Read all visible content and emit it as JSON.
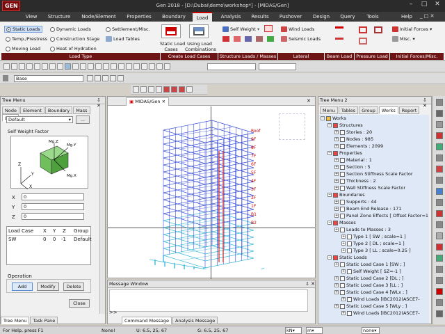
{
  "titlebar": {
    "text": "Gen 2018 - [D:\\Dubai\\demo\\workshop*] - [MIDAS/Gen]",
    "logo": "GEN"
  },
  "menu": {
    "tabs": [
      "View",
      "Structure",
      "Node/Element",
      "Properties",
      "Boundary",
      "Load",
      "Analysis",
      "Results",
      "Pushover",
      "Design",
      "Query",
      "Tools"
    ],
    "active": "Load",
    "help": "Help"
  },
  "ribbon": {
    "load_type_items": [
      "Static Loads",
      "Dynamic Loads",
      "Settlement/Misc.",
      "Temp./Prestress",
      "Construction Stage",
      "Heat of Hydration",
      "Moving Load"
    ],
    "load_type_sub": "Load Tables",
    "groups": [
      "Load Type",
      "Create Load Cases",
      "Structure Loads / Masses",
      "Lateral",
      "Beam Load",
      "Pressure Load",
      "Initial Forces/Misc."
    ],
    "static_load_cases": "Static Load\nCases",
    "static_load_cases_lines": [
      "Static Load",
      "Cases"
    ],
    "using_load_combinations_lines": [
      "Using Load",
      "Combinations"
    ],
    "self_weight": "Self Weight",
    "nodal_body_force": "",
    "wind_loads": "Wind Loads",
    "seismic_loads": "Seismic Loads",
    "initial_forces": "Initial Forces",
    "misc": "Misc."
  },
  "toolbar": {
    "base_field": "Base"
  },
  "tree_menu": {
    "title": "Tree Menu",
    "tabs": [
      "Node",
      "Element",
      "Boundary",
      "Mass",
      "Load"
    ],
    "active_tab": "Load",
    "default_select": "Default",
    "self_weight_factor": "Self Weight Factor",
    "axis_labels": [
      "Mg.Z",
      "Mg.Y",
      "Mg.X",
      "Z",
      "Y",
      "X"
    ],
    "x_label": "X",
    "x_value": "0",
    "y_label": "Y",
    "y_value": "0",
    "z_label": "Z",
    "z_value": "0",
    "table_headers": [
      "Load Case",
      "X",
      "Y",
      "Z",
      "Group"
    ],
    "table_row": [
      "SW",
      "0",
      "0",
      "-1",
      "Default"
    ],
    "operation": "Operation",
    "add": "Add",
    "modify": "Modify",
    "delete": "Delete",
    "close": "Close",
    "bottom_tabs": [
      "Tree Menu",
      "Task Pane"
    ]
  },
  "model_view": {
    "tab": "MIDAS/Gen",
    "story_labels": [
      "Roof",
      "9F",
      "8F",
      "7F",
      "6F",
      "5F",
      "4F",
      "3F",
      "2F",
      "1F",
      "B1",
      "B2"
    ]
  },
  "message_window": {
    "title": "Message Window",
    "prompt": ">>",
    "tabs": [
      "Command Message",
      "Analysis Message"
    ]
  },
  "tree_menu2": {
    "title": "Tree Menu 2",
    "tabs": [
      "Menu",
      "Tables",
      "Group",
      "Works",
      "Report"
    ],
    "active_tab": "Works",
    "items": [
      {
        "level": 0,
        "text": "Works"
      },
      {
        "level": 1,
        "text": "Structures"
      },
      {
        "level": 2,
        "text": "Stories : 20"
      },
      {
        "level": 2,
        "text": "Nodes : 985"
      },
      {
        "level": 2,
        "text": "Elements : 2099"
      },
      {
        "level": 1,
        "text": "Properties"
      },
      {
        "level": 2,
        "text": "Material : 1"
      },
      {
        "level": 2,
        "text": "Section : 5"
      },
      {
        "level": 2,
        "text": "Section Stiffness Scale Factor"
      },
      {
        "level": 2,
        "text": "Thickness : 2"
      },
      {
        "level": 2,
        "text": "Wall Stiffness Scale Factor"
      },
      {
        "level": 1,
        "text": "Boundaries"
      },
      {
        "level": 2,
        "text": "Supports : 44"
      },
      {
        "level": 2,
        "text": "Beam End Release : 171"
      },
      {
        "level": 2,
        "text": "Panel Zone Effects [ Offset Factor=1 ;"
      },
      {
        "level": 1,
        "text": "Masses"
      },
      {
        "level": 2,
        "text": "Loads to Masses : 3"
      },
      {
        "level": 3,
        "text": "Type 1 [ SW ; scale=1 ]"
      },
      {
        "level": 3,
        "text": "Type 2 [ DL ; scale=1 ]"
      },
      {
        "level": 3,
        "text": "Type 3 [ LL ; scale=0.25 ]"
      },
      {
        "level": 1,
        "text": "Static Loads"
      },
      {
        "level": 2,
        "text": "Static Load Case 1 [SW ; ]"
      },
      {
        "level": 3,
        "text": "Self Weight [ SZ=-1 ]"
      },
      {
        "level": 2,
        "text": "Static Load Case 2 [DL ; ]"
      },
      {
        "level": 2,
        "text": "Static Load Case 3 [LL ; ]"
      },
      {
        "level": 2,
        "text": "Static Load Case 4 [WLx ; ]"
      },
      {
        "level": 3,
        "text": "Wind Loads [IBC2012(ASCE7-"
      },
      {
        "level": 2,
        "text": "Static Load Case 5 [WLy ; ]"
      },
      {
        "level": 3,
        "text": "Wind Loads [IBC2012(ASCE7-"
      }
    ]
  },
  "status": {
    "help": "For Help, press F1",
    "sel": "None!",
    "u": "U: 6.5, 25, 67",
    "g": "G: 6.5, 25, 67",
    "unit_force": "kN",
    "unit_len": "m",
    "none": "none"
  },
  "colors": {
    "accent": "#c00000",
    "group_bar": "#6d1414",
    "tree_bg": "#dfe8f6",
    "frame_blue": "#3a4fd8",
    "frame_cyan": "#3ab8d8",
    "frame_red": "#d02020"
  }
}
